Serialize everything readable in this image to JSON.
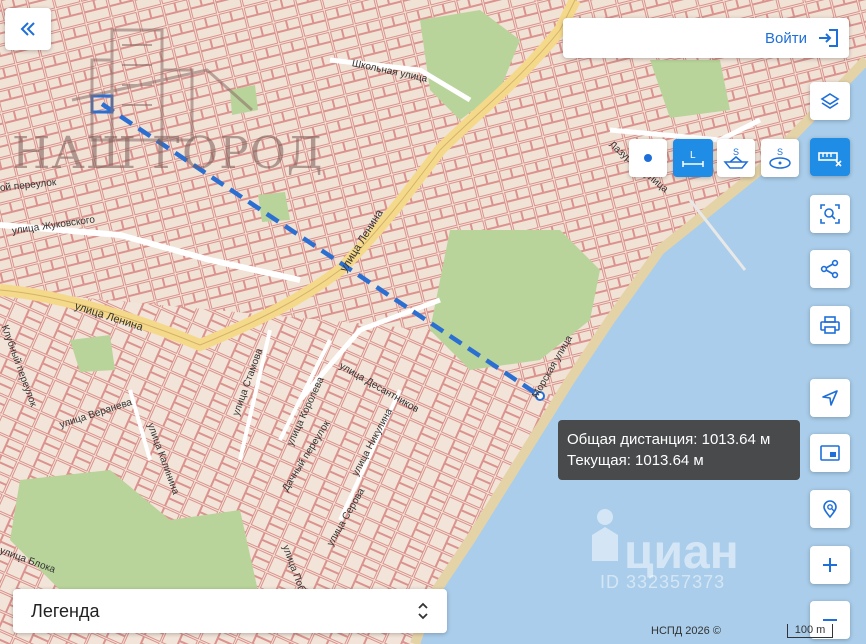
{
  "header": {
    "back_icon": "double-chevron-left-icon",
    "login_label": "Войти",
    "login_icon": "sign-in-icon"
  },
  "watermark": {
    "brand": "НАШ ГОРОД",
    "service": "циан",
    "listing_id": "ID 332357373"
  },
  "streets": {
    "lenina_1": "улица Ленина",
    "lenina_2": "улица Ленина",
    "shkolnaya": "Школьная улица",
    "zhukovskogo": "улица Жуковского",
    "pereulok": "ой переулок",
    "desantnikov": "улица Десантников",
    "korolyova": "улица Королева",
    "stamova": "улица Стамова",
    "kalinina": "улица Калинина",
    "veraneva": "улица Веранева",
    "nikulina": "улица Никулина",
    "dachny": "Дачный переулок",
    "pobedy": "улица Победы",
    "serova": "улица Серова",
    "bloka": "улица Блока",
    "morskaya": "Морская улица",
    "lazurnaya": "Лазурная улица",
    "klubny": "Клубный переулок"
  },
  "measure_modes": [
    {
      "id": "point",
      "icon": "point-icon",
      "active": false
    },
    {
      "id": "line",
      "icon": "line-measure-icon",
      "label": "L",
      "active": true
    },
    {
      "id": "area",
      "icon": "area-measure-icon",
      "label": "S",
      "active": false
    },
    {
      "id": "circle",
      "icon": "circle-measure-icon",
      "label": "S",
      "active": false
    }
  ],
  "right_controls": [
    {
      "name": "layers-button",
      "icon": "layers-icon",
      "active": false
    },
    {
      "name": "measure-tool-button",
      "icon": "ruler-icon",
      "active": true
    },
    {
      "name": "select-area-button",
      "icon": "select-search-icon",
      "active": false
    },
    {
      "name": "share-button",
      "icon": "share-icon",
      "active": false
    },
    {
      "name": "print-button",
      "icon": "printer-icon",
      "active": false
    },
    {
      "name": "locate-button",
      "icon": "navigation-arrow-icon",
      "active": false
    },
    {
      "name": "minimap-button",
      "icon": "minimap-icon",
      "active": false
    },
    {
      "name": "search-location-button",
      "icon": "location-search-icon",
      "active": false
    },
    {
      "name": "zoom-in-button",
      "icon": "plus-icon",
      "active": false
    },
    {
      "name": "zoom-out-button",
      "icon": "minus-icon",
      "active": false
    }
  ],
  "tooltip": {
    "total_label": "Общая дистанция: 1013.64 м",
    "current_label": "Текущая: 1013.64 м"
  },
  "legend": {
    "label": "Легенда",
    "icon": "chevron-up-down-icon"
  },
  "footer": {
    "credit": "НСПД 2026 ©",
    "scale_label": "100 m"
  },
  "colors": {
    "accent": "#1f8ce6",
    "route": "#2a6fd1",
    "water": "#a9cdea",
    "road_main": "#f5d98b",
    "parcel_line": "#d98080",
    "park": "#b9d49a"
  }
}
